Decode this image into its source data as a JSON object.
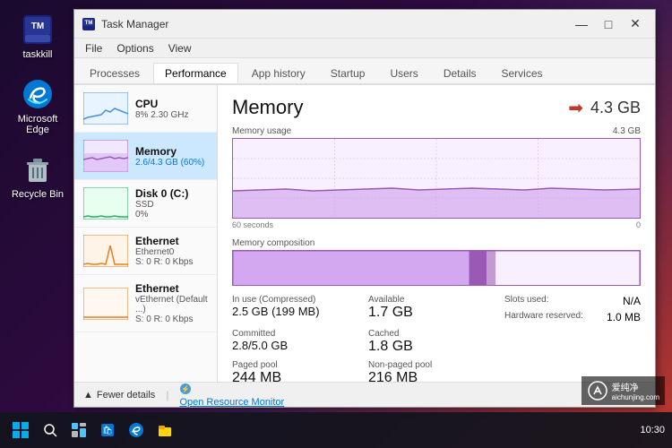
{
  "desktop": {
    "background": "linear-gradient(135deg, #1a0a2e, #c0392b)"
  },
  "window": {
    "title": "Task Manager",
    "titlebar_icon": "📊"
  },
  "menu": {
    "items": [
      "File",
      "Options",
      "View"
    ]
  },
  "tabs": [
    {
      "label": "Processes",
      "active": false
    },
    {
      "label": "Performance",
      "active": true
    },
    {
      "label": "App history",
      "active": false
    },
    {
      "label": "Startup",
      "active": false
    },
    {
      "label": "Users",
      "active": false
    },
    {
      "label": "Details",
      "active": false
    },
    {
      "label": "Services",
      "active": false
    }
  ],
  "left_panel": {
    "items": [
      {
        "name": "CPU",
        "sub": "8% 2.30 GHz",
        "value": "",
        "active": false,
        "color": "#4a90d9"
      },
      {
        "name": "Memory",
        "sub": "2.6/4.3 GB (60%)",
        "value": "",
        "active": true,
        "color": "#9b59b6"
      },
      {
        "name": "Disk 0 (C:)",
        "sub": "SSD",
        "value": "0%",
        "active": false,
        "color": "#27ae60"
      },
      {
        "name": "Ethernet",
        "sub": "Ethernet0",
        "value": "S: 0 R: 0 Kbps",
        "active": false,
        "color": "#e67e22"
      },
      {
        "name": "Ethernet",
        "sub": "vEthernet (Default ...)",
        "value": "S: 0 R: 0 Kbps",
        "active": false,
        "color": "#e67e22"
      }
    ]
  },
  "main": {
    "title": "Memory",
    "total": "4.3 GB",
    "chart_label": "Memory usage",
    "chart_max": "4.3 GB",
    "time_start": "60 seconds",
    "time_end": "0",
    "composition_label": "Memory composition",
    "stats": [
      {
        "label": "In use (Compressed)",
        "value": "2.5 GB (199 MB)",
        "large": true
      },
      {
        "label": "Available",
        "value": "1.7 GB",
        "large": true
      },
      {
        "label": "Committed",
        "value": "2.8/5.0 GB",
        "large": true
      },
      {
        "label": "Cached",
        "value": "1.8 GB",
        "large": true
      },
      {
        "label": "Paged pool",
        "value": "244 MB",
        "large": true
      },
      {
        "label": "Non-paged pool",
        "value": "216 MB",
        "large": true
      }
    ],
    "right_stats": [
      {
        "label": "Slots used:",
        "value": "N/A"
      },
      {
        "label": "Hardware reserved:",
        "value": "1.0 MB"
      }
    ]
  },
  "bottom_bar": {
    "fewer_details": "Fewer details",
    "open_resource_monitor": "Open Resource Monitor"
  },
  "desktop_icons": [
    {
      "label": "taskkill",
      "icon": "⬛"
    },
    {
      "label": "Microsoft Edge",
      "icon": "🌐"
    },
    {
      "label": "Recycle Bin",
      "icon": "🗑️"
    }
  ],
  "watermark": {
    "text": "爱纯净",
    "subtext": "aichunjing.com"
  }
}
